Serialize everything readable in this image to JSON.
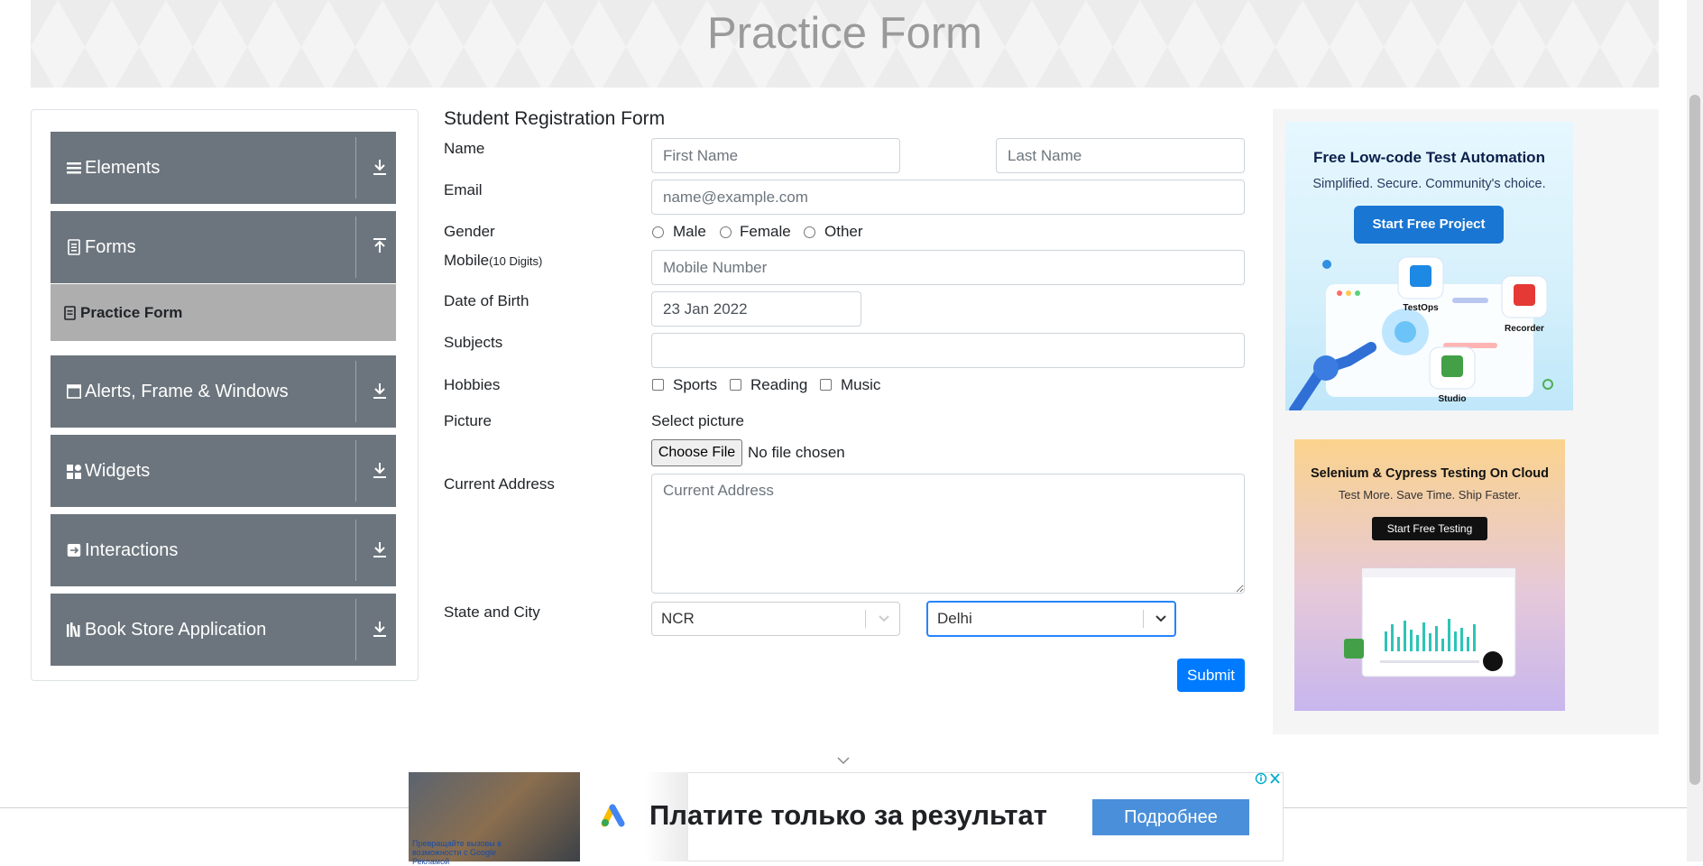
{
  "header": {
    "title": "Practice Form"
  },
  "sidebar": {
    "groups": [
      {
        "label": "Elements",
        "icon": "list-icon",
        "state": "collapsed"
      },
      {
        "label": "Forms",
        "icon": "document-icon",
        "state": "expanded"
      },
      {
        "label": "Alerts, Frame & Windows",
        "icon": "window-icon",
        "state": "collapsed"
      },
      {
        "label": "Widgets",
        "icon": "grid-icon",
        "state": "collapsed"
      },
      {
        "label": "Interactions",
        "icon": "interaction-icon",
        "state": "collapsed"
      },
      {
        "label": "Book Store Application",
        "icon": "books-icon",
        "state": "collapsed"
      }
    ],
    "active_item": "Practice Form"
  },
  "form": {
    "title": "Student Registration Form",
    "name_label": "Name",
    "first_name_placeholder": "First Name",
    "last_name_placeholder": "Last Name",
    "email_label": "Email",
    "email_placeholder": "name@example.com",
    "gender_label": "Gender",
    "gender_options": [
      "Male",
      "Female",
      "Other"
    ],
    "mobile_label": "Mobile",
    "mobile_hint": "(10 Digits)",
    "mobile_placeholder": "Mobile Number",
    "dob_label": "Date of Birth",
    "dob_value": "23 Jan 2022",
    "subjects_label": "Subjects",
    "hobbies_label": "Hobbies",
    "hobbies_options": [
      "Sports",
      "Reading",
      "Music"
    ],
    "picture_label": "Picture",
    "picture_select_text": "Select picture",
    "choose_file_label": "Choose File",
    "no_file_text": "No file chosen",
    "address_label": "Current Address",
    "address_placeholder": "Current Address",
    "state_city_label": "State and City",
    "state_value": "NCR",
    "city_value": "Delhi",
    "submit_label": "Submit"
  },
  "ads": {
    "katalon": {
      "title": "Free Low-code Test Automation",
      "subtitle": "Simplified. Secure. Community's choice.",
      "button": "Start Free Project",
      "products": [
        "TestOps",
        "Recorder",
        "Studio"
      ]
    },
    "lambdatest": {
      "title": "Selenium & Cypress Testing On Cloud",
      "subtitle": "Test More. Save Time. Ship Faster.",
      "button": "Start Free Testing"
    },
    "bottom": {
      "headline": "Платите только за результат",
      "button": "Подробнее",
      "caption": "Превращайте вызовы в возможности с Google Рекламой"
    }
  },
  "colors": {
    "sidebar_group_bg": "#6c757d",
    "sidebar_active_bg": "#aeaeae",
    "primary": "#007bff",
    "focus_border": "#2684ff"
  }
}
